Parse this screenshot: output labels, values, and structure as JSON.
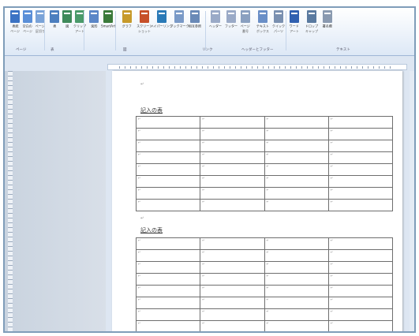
{
  "ribbon": {
    "buttons": [
      {
        "icon": "cover-page-icon",
        "label": "表紙",
        "sub": "ページ"
      },
      {
        "icon": "blank-page-icon",
        "label": "空白の",
        "sub": "ページ"
      },
      {
        "icon": "page-break-icon",
        "label": "ページ",
        "sub": "区切り"
      },
      {
        "icon": "table-icon",
        "label": "表",
        "sub": ""
      },
      {
        "icon": "picture-icon",
        "label": "図",
        "sub": ""
      },
      {
        "icon": "clipart-icon",
        "label": "クリップ",
        "sub": "アート"
      },
      {
        "icon": "shapes-icon",
        "label": "図形",
        "sub": ""
      },
      {
        "icon": "smartart-icon",
        "label": "SmartArt",
        "sub": ""
      },
      {
        "icon": "chart-icon",
        "label": "グラフ",
        "sub": ""
      },
      {
        "icon": "screenshot-icon",
        "label": "スクリーン",
        "sub": "ショット"
      },
      {
        "icon": "hyperlink-icon",
        "label": "ハイパーリンク",
        "sub": ""
      },
      {
        "icon": "bookmark-icon",
        "label": "ブックマーク",
        "sub": ""
      },
      {
        "icon": "cross-reference-icon",
        "label": "相互参照",
        "sub": ""
      },
      {
        "icon": "header-icon",
        "label": "ヘッダー",
        "sub": ""
      },
      {
        "icon": "footer-icon",
        "label": "フッター",
        "sub": ""
      },
      {
        "icon": "page-number-icon",
        "label": "ページ",
        "sub": "番号"
      },
      {
        "icon": "textbox-icon",
        "label": "テキスト",
        "sub": "ボックス"
      },
      {
        "icon": "quick-parts-icon",
        "label": "クイック",
        "sub": "パーツ"
      },
      {
        "icon": "wordart-icon",
        "label": "ワード",
        "sub": "アート"
      },
      {
        "icon": "dropcap-icon",
        "label": "ドロップ",
        "sub": "キャップ"
      },
      {
        "icon": "signature-icon",
        "label": "署名欄",
        "sub": ""
      }
    ],
    "groups": [
      "ページ",
      "表",
      "図",
      "リンク",
      "ヘッダーとフッター",
      "テキスト"
    ]
  },
  "document": {
    "para_mark": "↵",
    "section1": {
      "caption": "記入の表"
    },
    "section2": {
      "caption": "記入の表"
    },
    "tables": {
      "rows": 8,
      "cols": 4
    }
  },
  "colors": {
    "ribbon_top": "#ffffff",
    "ribbon_bottom": "#dde8f6",
    "workspace": "#c9d3df",
    "table_border": "#6e6e6e",
    "frame_border": "#7f9db9"
  }
}
